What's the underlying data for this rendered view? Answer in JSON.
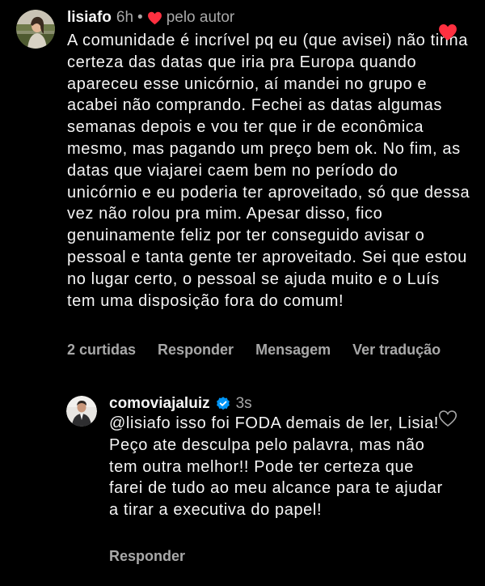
{
  "theme": {
    "background": "#000000",
    "text": "#f5f5f5",
    "secondary_text": "#a8a8a8",
    "heart_red": "#ff3040",
    "verified_blue": "#0095f6"
  },
  "comments": [
    {
      "username": "lisiafo",
      "time": "6h",
      "separator": "•",
      "author_like_icon": "heart-filled-icon",
      "author_like_label": "pelo autor",
      "text": "A comunidade é incrível pq eu (que avisei) não tinha certeza das datas que iria pra Europa quando apareceu esse unicórnio, aí mandei no grupo e acabei não comprando. Fechei as datas algumas semanas depois e vou ter que ir de econômica mesmo, mas pagando um preço bem ok. No fim, as datas que viajarei caem bem no período do unicórnio e eu poderia ter aproveitado, só que dessa vez não rolou pra mim. Apesar disso, fico genuinamente feliz por ter conseguido avisar o pessoal e tanta gente ter aproveitado. Sei que estou no lugar certo, o pessoal se ajuda muito e o Luís tem uma disposição fora do comum!",
      "actions": {
        "likes": "2 curtidas",
        "reply": "Responder",
        "message": "Mensagem",
        "translate": "Ver tradução"
      },
      "like_icon": "heart-filled-icon",
      "liked": true
    },
    {
      "username": "comoviajaluiz",
      "verified_icon": "verified-badge-icon",
      "time": "3s",
      "text": "@lisiafo isso foi FODA demais de ler, Lisia! Peço ate desculpa pelo palavra, mas não tem outra melhor!! Pode ter certeza que farei de tudo ao meu alcance para te ajudar a tirar a executiva do papel!",
      "actions": {
        "reply": "Responder"
      },
      "like_icon": "heart-outline-icon",
      "liked": false
    }
  ]
}
